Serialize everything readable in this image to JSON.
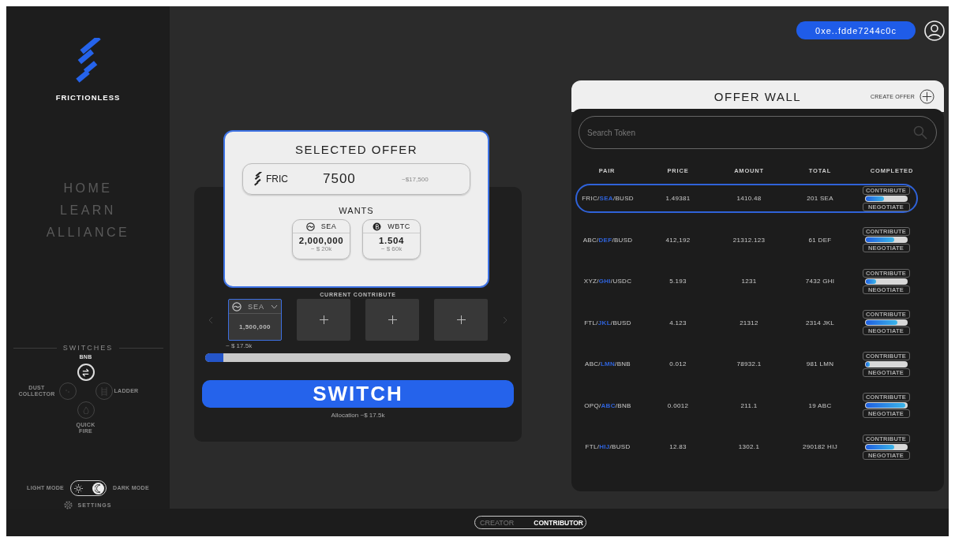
{
  "sidebar": {
    "brand": "FRICTIONLESS",
    "nav": [
      {
        "label": "HOME"
      },
      {
        "label": "LEARN"
      },
      {
        "label": "ALLIANCE"
      }
    ],
    "switches": {
      "title": "SWITCHES",
      "items": [
        {
          "label": "BNB",
          "kind": "swap",
          "selected": true
        },
        {
          "label": "DUST COLLECTOR",
          "kind": "dust",
          "selected": false
        },
        {
          "label": "LADDER",
          "kind": "ladder",
          "selected": false
        },
        {
          "label": "QUICK FIRE",
          "kind": "fire",
          "selected": false
        }
      ]
    },
    "theme": {
      "light_label": "LIGHT MODE",
      "dark_label": "DARK MODE",
      "dark": true
    },
    "settings": "SETTINGS"
  },
  "header": {
    "wallet": "0xe..fdde7244c0c"
  },
  "selected_offer": {
    "title": "SELECTED OFFER",
    "token": "FRIC",
    "amount": "7500",
    "value": "~$17,500",
    "wants_title": "WANTS",
    "wants": [
      {
        "kind": "sea",
        "token": "SEA",
        "amount": "2,000,000",
        "value": "~ $ 20k"
      },
      {
        "kind": "btc",
        "token": "WBTC",
        "amount": "1.504",
        "value": "~ $ 60k"
      }
    ]
  },
  "contribute": {
    "title": "CURRENT CONTRIBUTE",
    "slots": [
      {
        "kind": "token",
        "token": "SEA",
        "amount": "1,500,000",
        "selected": true
      },
      {
        "kind": "empty",
        "selected": false
      },
      {
        "kind": "empty",
        "selected": false
      },
      {
        "kind": "empty",
        "selected": false
      }
    ],
    "value": "~ $ 17.5k",
    "level": 0.06,
    "button": "SWITCH",
    "allocation": "Allocation ~$ 17.5k"
  },
  "offer_wall": {
    "title": "OFFER WALL",
    "create": "CREATE OFFER",
    "search": {
      "placeholder": "Search Token"
    },
    "columns": [
      "PAIR",
      "PRICE",
      "AMOUNT",
      "TOTAL",
      "COMPLETED"
    ],
    "rows": [
      {
        "pair": "FRIC/**SEA**/BUSD",
        "price": "1.49381",
        "amount": "1410.48",
        "total": "201 SEA",
        "level": 0.45,
        "selected": true,
        "contribute": "CONTRIBUTE",
        "negotiate": "NEGOTIATE"
      },
      {
        "pair": "ABC/**DEF**/BUSD",
        "price": "412,192",
        "amount": "21312.123",
        "total": "61 DEF",
        "level": 0.7,
        "selected": false,
        "contribute": "CONTRIBUTE",
        "negotiate": "NEGOTIATE"
      },
      {
        "pair": "XYZ/**GHI**/USDC",
        "price": "5.193",
        "amount": "1231",
        "total": "7432 GHI",
        "level": 0.25,
        "selected": false,
        "contribute": "CONTRIBUTE",
        "negotiate": "NEGOTIATE"
      },
      {
        "pair": "FTL/**JKL**/BUSD",
        "price": "4.123",
        "amount": "21312",
        "total": "2314 JKL",
        "level": 0.77,
        "selected": false,
        "contribute": "CONTRIBUTE",
        "negotiate": "NEGOTIATE"
      },
      {
        "pair": "ABC/**LMN**/BNB",
        "price": "0.012",
        "amount": "78932.1",
        "total": "981 LMN",
        "level": 0.1,
        "selected": false,
        "contribute": "CONTRIBUTE",
        "negotiate": "NEGOTIATE"
      },
      {
        "pair": "OPQ/**ABC**/BNB",
        "price": "0.0012",
        "amount": "211.1",
        "total": "19 ABC",
        "level": 0.98,
        "selected": false,
        "contribute": "CONTRIBUTE",
        "negotiate": "NEGOTIATE"
      },
      {
        "pair": "FTL/**HIJ**/BUSD",
        "price": "12.83",
        "amount": "1302.1",
        "total": "290182 HIJ",
        "level": 0.7,
        "selected": false,
        "contribute": "CONTRIBUTE",
        "negotiate": "NEGOTIATE"
      }
    ]
  },
  "role_toggle": [
    {
      "label": "CREATOR",
      "selected": false
    },
    {
      "label": "CONTRIBUTOR",
      "selected": true
    }
  ]
}
